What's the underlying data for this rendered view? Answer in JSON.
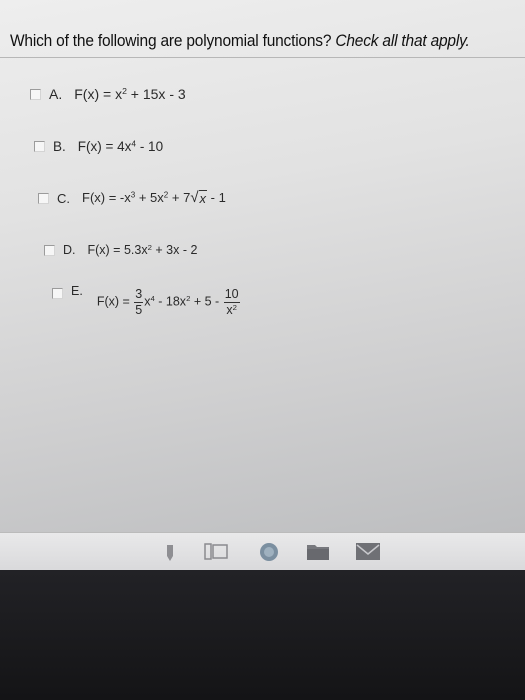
{
  "question": {
    "prefix": "Which of the following are polynomial functions?",
    "instruction": "Check all that apply."
  },
  "options": {
    "a": {
      "letter": "A.",
      "lhs": "F(x) = x",
      "e1": "2",
      "rest": " + 15x - 3"
    },
    "b": {
      "letter": "B.",
      "lhs": "F(x) = 4x",
      "e1": "4",
      "rest": " - 10"
    },
    "c": {
      "letter": "C.",
      "lhs": "F(x) = -x",
      "e1": "3",
      "mid1": " + 5x",
      "e2": "2",
      "mid2": " + 7",
      "radicand": "x",
      "rest": " - 1"
    },
    "d": {
      "letter": "D.",
      "lhs": "F(x) = 5.3x",
      "e1": "2",
      "rest": " + 3x - 2"
    },
    "e": {
      "letter": "E.",
      "lhs": "F(x) = ",
      "f1num": "3",
      "f1den": "5",
      "t1": "x",
      "e1": "4",
      "t2": " - 18x",
      "e2": "2",
      "t3": " + 5 - ",
      "f2num": "10",
      "f2den": "x",
      "f2e": "2"
    }
  },
  "taskbar": {
    "icons": [
      "pen-icon",
      "task-view-icon",
      "browser-icon",
      "folder-icon",
      "mail-icon"
    ]
  }
}
